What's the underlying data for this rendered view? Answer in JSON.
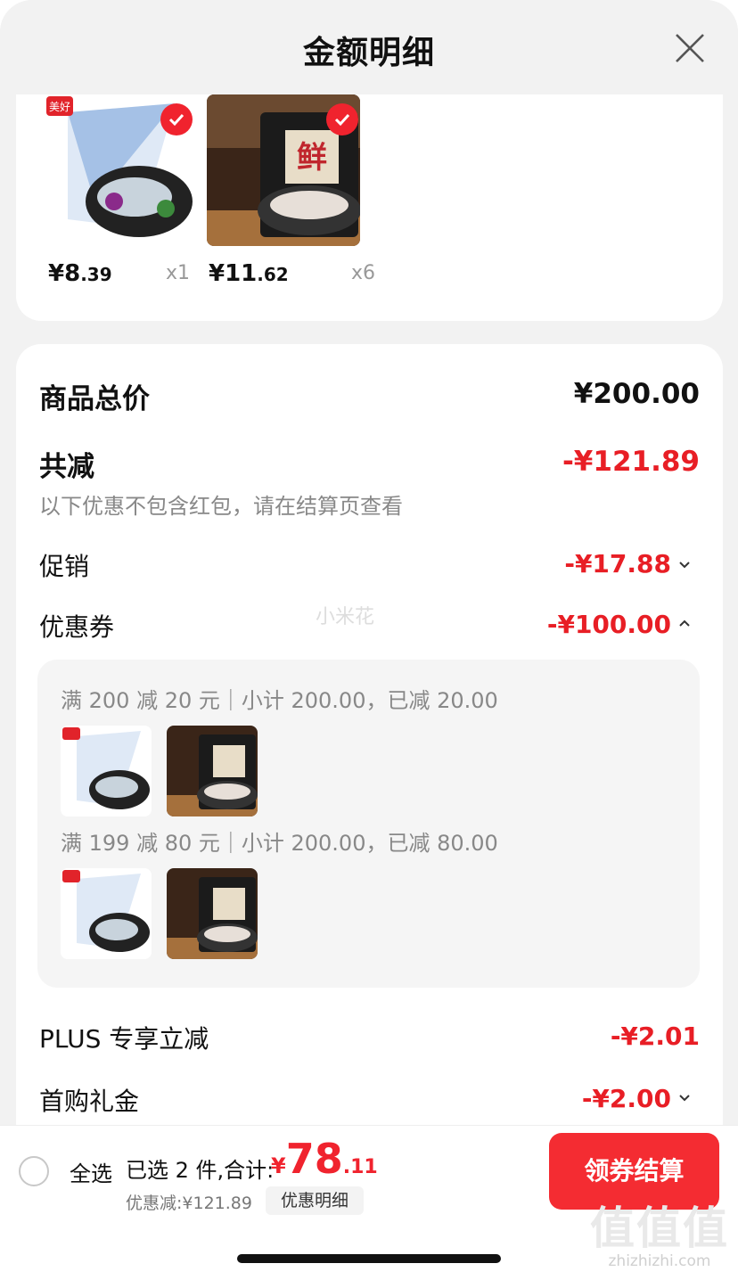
{
  "header": {
    "title": "金额明细"
  },
  "products": [
    {
      "price_int": "¥8",
      "price_dec": ".39",
      "qty": "x1",
      "brand": "美好"
    },
    {
      "price_int": "¥11",
      "price_dec": ".62",
      "qty": "x6",
      "badge": "鲜"
    }
  ],
  "summary": {
    "total_label": "商品总价",
    "total_value": "¥200.00",
    "reduce_label": "共减",
    "reduce_value": "-¥121.89",
    "note": "以下优惠不包含红包，请在结算页查看",
    "promo_label": "促销",
    "promo_value": "-¥17.88",
    "coupon_label": "优惠券",
    "coupon_value": "-¥100.00",
    "watermark": "小米花",
    "coupons": [
      {
        "text": "满 200 减 20 元｜小计 200.00，已减 20.00"
      },
      {
        "text": "满 199 减 80 元｜小计 200.00，已减 80.00"
      }
    ],
    "plus_label": "PLUS 专享立减",
    "plus_value": "-¥2.01",
    "first_label": "首购礼金",
    "first_value": "-¥2.00"
  },
  "bottom": {
    "select_all": "全选",
    "selected": "已选 2 件,合计:",
    "total_cur": "¥",
    "total_int": "78",
    "total_dec": ".11",
    "discount": "优惠减:¥121.89",
    "detail_button": "优惠明细",
    "checkout_button": "领券结算"
  },
  "logo": {
    "big": "值值值",
    "small": "zhizhizhi.com"
  },
  "colors": {
    "accent": "#f0232e",
    "background": "#f2f2f2"
  },
  "icons": [
    "close-icon",
    "check-icon",
    "chevron-down-icon",
    "chevron-up-icon"
  ]
}
